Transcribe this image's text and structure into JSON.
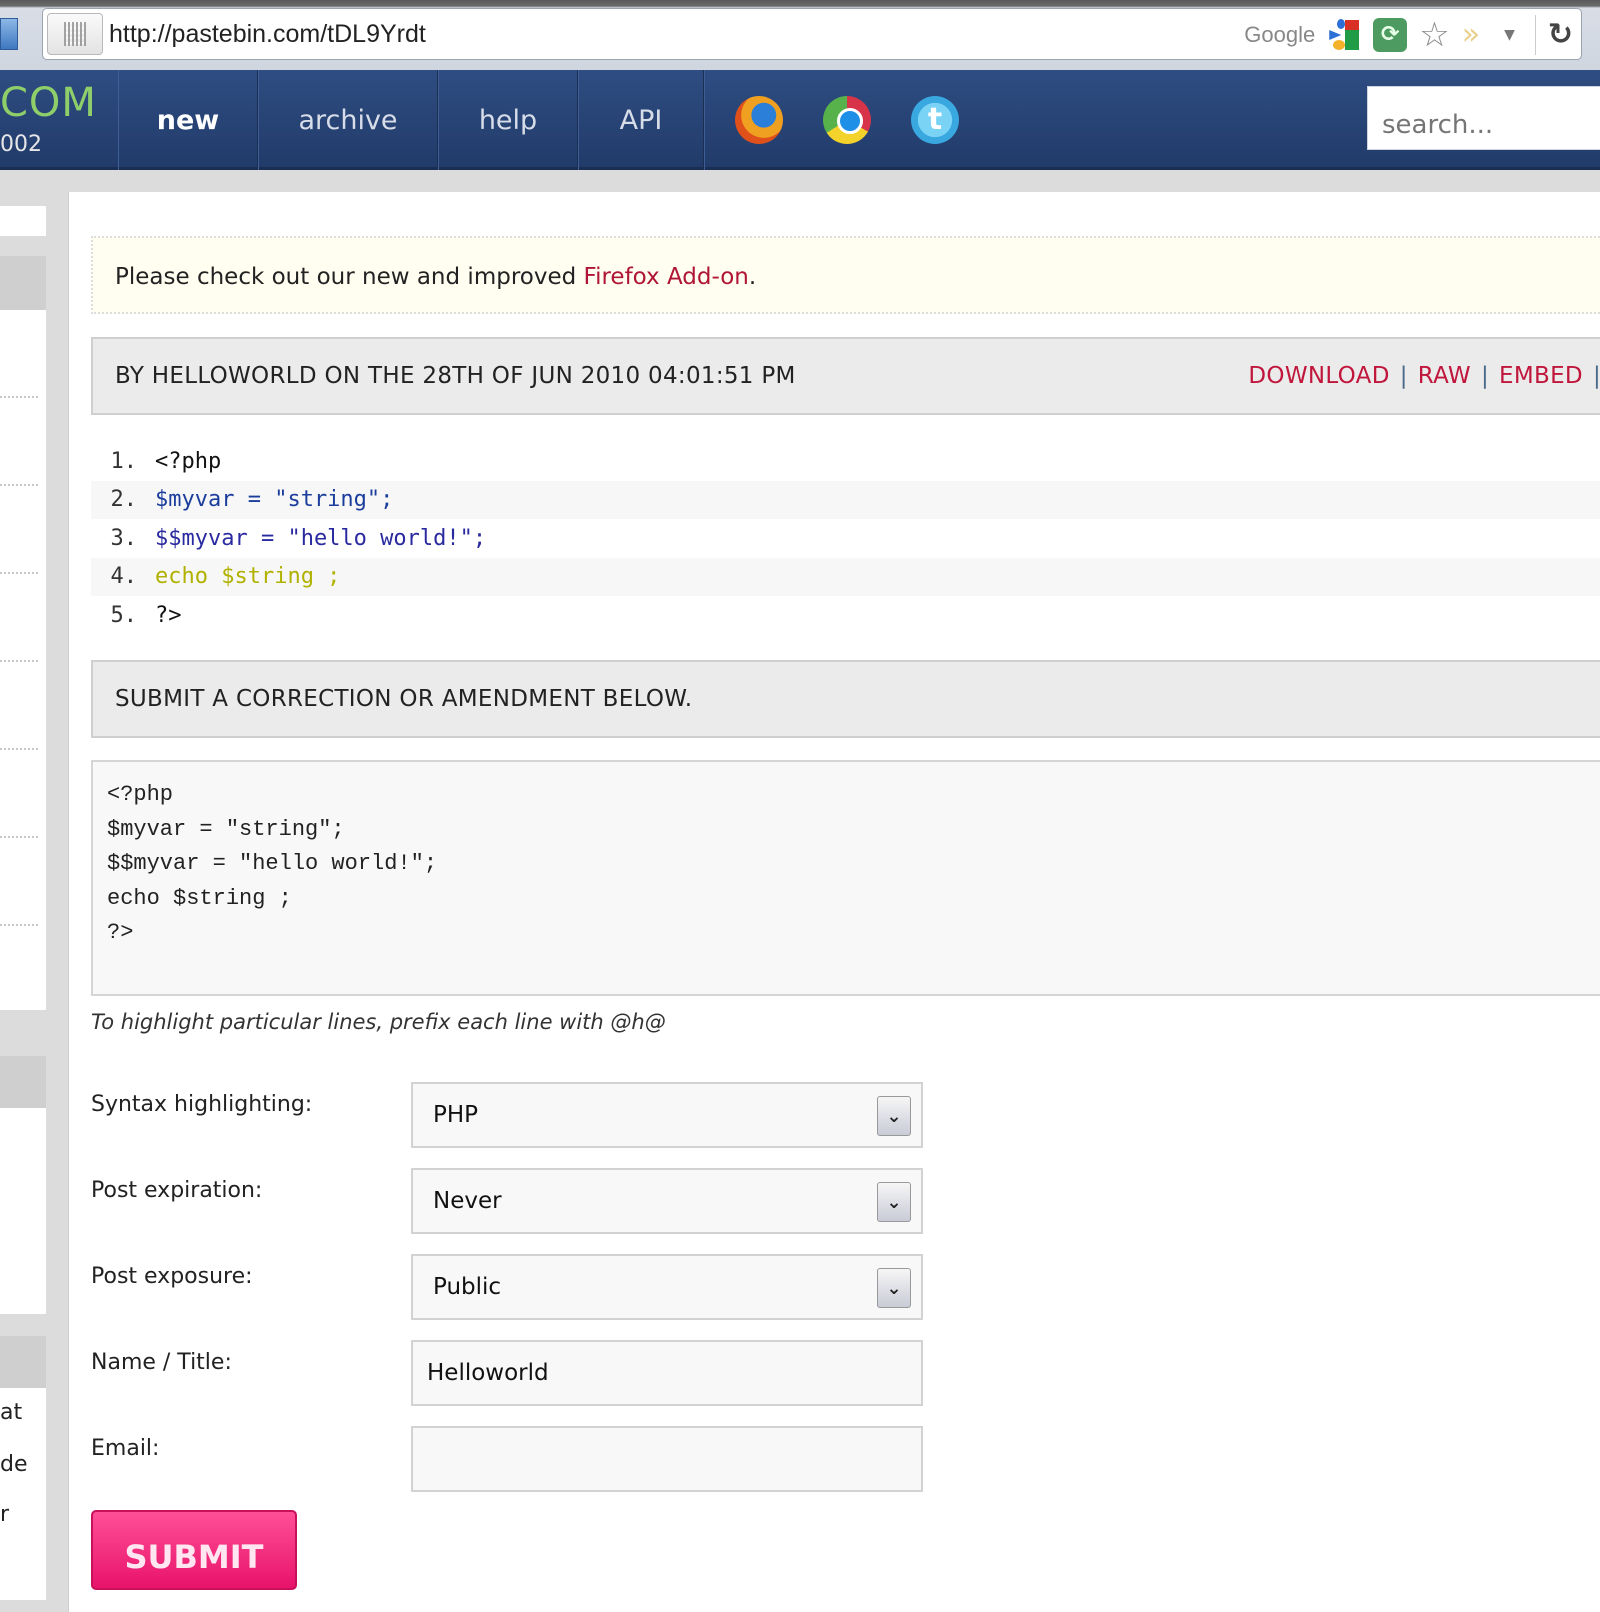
{
  "browser": {
    "url": "http://pastebin.com/tDL9Yrdt",
    "search_engine_label": "Google",
    "icons": [
      "page-icon",
      "google-icon",
      "sync-icon",
      "bookmark-star-icon",
      "extension-chevron-icon",
      "dropdown-arrow-icon",
      "reload-icon"
    ]
  },
  "header": {
    "logo_text": "COM",
    "logo_sub": "002",
    "nav": [
      {
        "label": "new",
        "active": true
      },
      {
        "label": "archive",
        "active": false
      },
      {
        "label": "help",
        "active": false
      },
      {
        "label": "API",
        "active": false
      }
    ],
    "addon_icons": [
      "firefox-icon",
      "chrome-icon",
      "twitter-icon"
    ],
    "search_placeholder": "search..."
  },
  "sidebar": {
    "clipped_text": [
      "at",
      "de",
      "r"
    ]
  },
  "notice": {
    "text": "Please check out our new and improved ",
    "link": "Firefox Add-on",
    "suffix": "."
  },
  "paste": {
    "meta": "BY HELLOWORLD ON THE 28TH OF JUN 2010 04:01:51 PM",
    "actions": [
      "DOWNLOAD",
      "RAW",
      "EMBED"
    ],
    "action_separator": "|",
    "lines": [
      {
        "num": "1.",
        "code": "<?php"
      },
      {
        "num": "2.",
        "code": "$myvar = \"string\";"
      },
      {
        "num": "3.",
        "code": "$$myvar = \"hello world!\";"
      },
      {
        "num": "4.",
        "code": "echo $string ;"
      },
      {
        "num": "5.",
        "code": "?>"
      }
    ]
  },
  "amend": {
    "heading": "SUBMIT A CORRECTION OR AMENDMENT BELOW.",
    "heading_clipped_link": "/",
    "textarea_value": "<?php\n$myvar = \"string\";\n$$myvar = \"hello world!\";\necho $string ;\n?>",
    "hint": "To highlight particular lines, prefix each line with @h@"
  },
  "form": {
    "syntax": {
      "label": "Syntax highlighting:",
      "value": "PHP"
    },
    "expiration": {
      "label": "Post expiration:",
      "value": "Never"
    },
    "exposure": {
      "label": "Post exposure:",
      "value": "Public"
    },
    "name": {
      "label": "Name / Title:",
      "value": "Helloworld"
    },
    "email": {
      "label": "Email:",
      "value": ""
    },
    "submit_label": "SUBMIT"
  },
  "colors": {
    "nav_bg": "#2f4d82",
    "logo_green": "#8fcf6a",
    "link_red": "#c0163c",
    "submit_pink": "#e8136b",
    "notice_bg": "#fffef0",
    "code_keyword": "#b1b100",
    "code_var": "#1b3e9c",
    "code_string": "#2a2aa0"
  }
}
